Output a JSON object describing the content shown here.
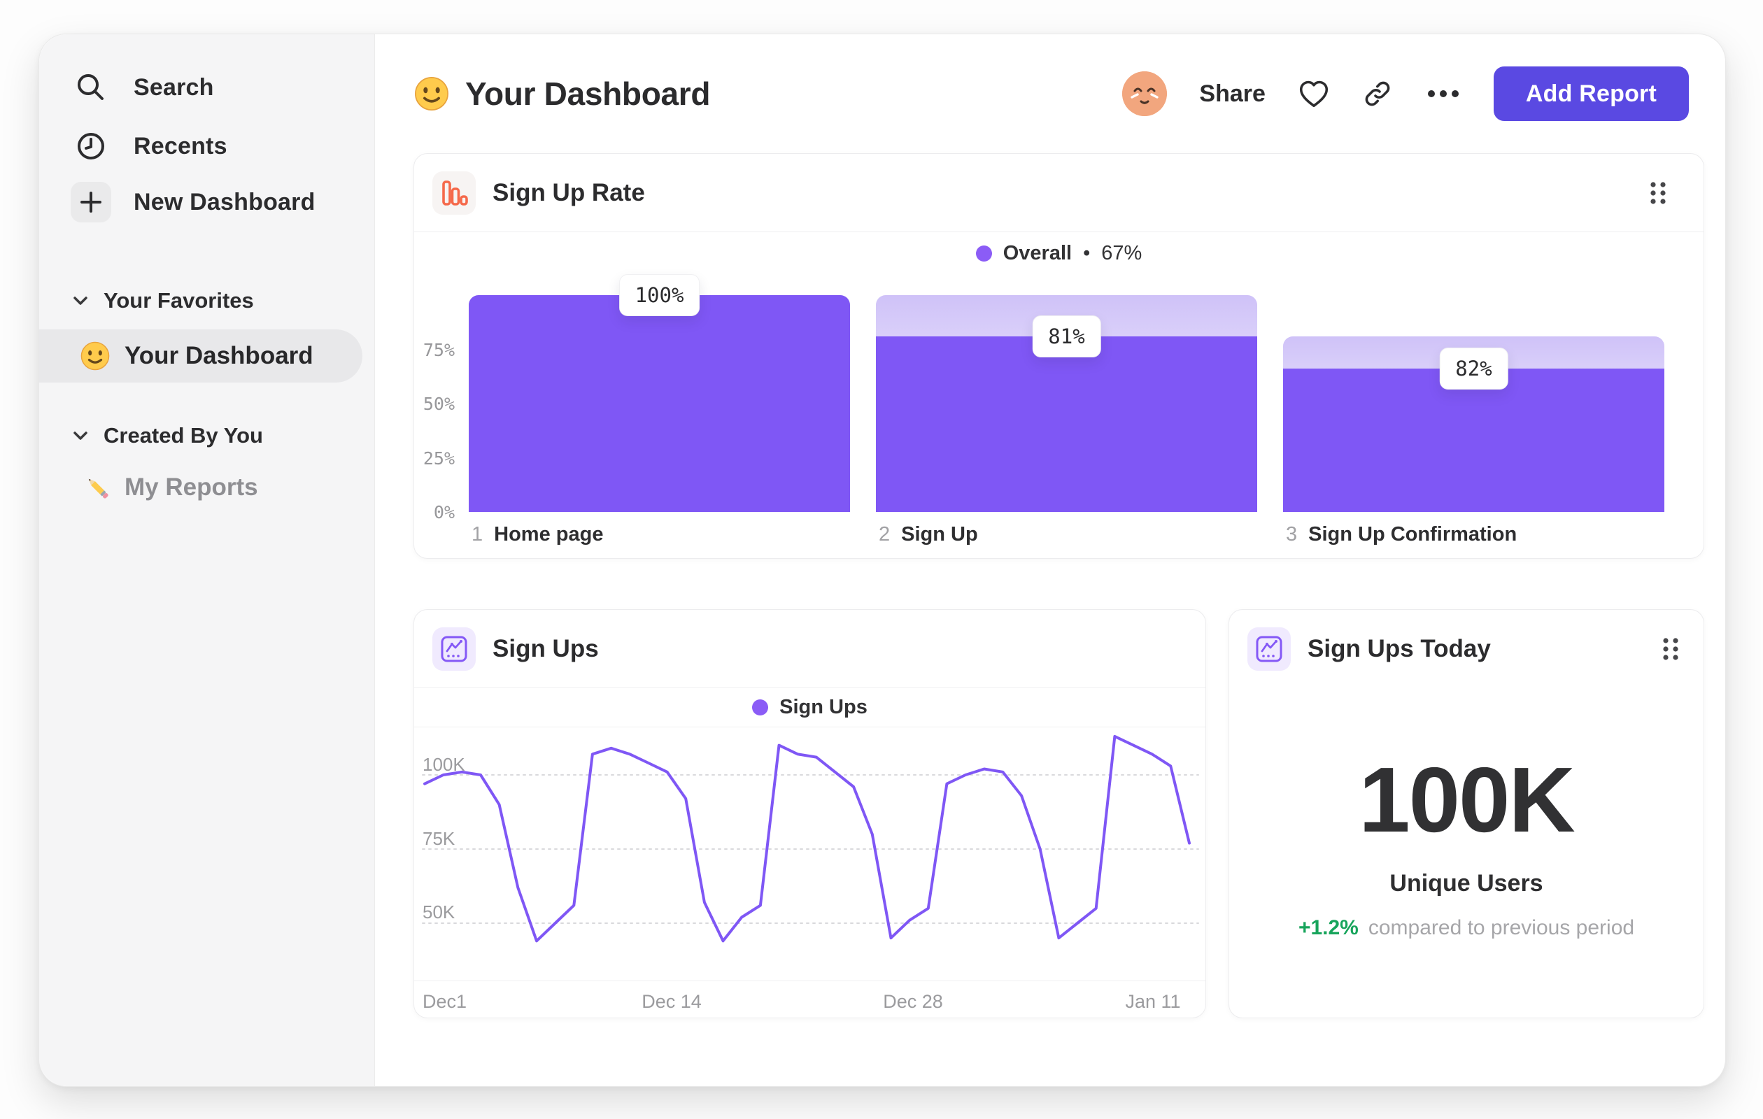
{
  "sidebar": {
    "items": [
      {
        "label": "Search",
        "icon": "search-icon"
      },
      {
        "label": "Recents",
        "icon": "clock-icon"
      },
      {
        "label": "New Dashboard",
        "icon": "plus-icon"
      }
    ],
    "sections": [
      {
        "title": "Your Favorites",
        "items": [
          {
            "label": "Your Dashboard",
            "icon": "smiley-emoji",
            "selected": true
          }
        ]
      },
      {
        "title": "Created By You",
        "items": [
          {
            "label": "My Reports",
            "icon": "pencil-emoji",
            "selected": false
          }
        ]
      }
    ]
  },
  "header": {
    "emoji": "smiley-emoji",
    "title": "Your Dashboard",
    "share_label": "Share",
    "add_report_label": "Add Report",
    "ellipsis": "•••"
  },
  "cards": {
    "sign_ups_today": {
      "title": "Sign Ups Today",
      "value": "100K",
      "metric_label": "Unique Users",
      "delta": "+1.2%",
      "delta_note": "compared to previous period"
    }
  },
  "colors": {
    "accent": "#7f57f5",
    "legend_dot": "#8b5cf6",
    "button": "#5a49e2",
    "positive": "#17a45b",
    "funnel_icon_orange": "#f5694b",
    "ghost_gradient_top": "#cfc2f8",
    "avatar_bg": "#f2a67e"
  },
  "chart_data": [
    {
      "type": "bar",
      "subtype": "funnel",
      "title": "Sign Up Rate",
      "legend": {
        "series": "Overall",
        "separator": "•",
        "value": "67%",
        "position": "top-center"
      },
      "categories": [
        "Home page",
        "Sign Up",
        "Sign Up Confirmation"
      ],
      "step_numbers": [
        "1",
        "2",
        "3"
      ],
      "step_conversion_labels": [
        "100%",
        "81%",
        "82%"
      ],
      "overall_pct": [
        100,
        81,
        66
      ],
      "ghost_pct": [
        null,
        100,
        81
      ],
      "y_ticks": [
        "0%",
        "25%",
        "50%",
        "75%"
      ],
      "ylim": [
        0,
        100
      ],
      "grid": false
    },
    {
      "type": "line",
      "title": "Sign Ups",
      "legend": {
        "series": "Sign Ups",
        "position": "top-center"
      },
      "x_tick_labels": [
        "Dec1",
        "Dec 14",
        "Dec 28",
        "Jan 11"
      ],
      "y_ticks": [
        {
          "label": "100K",
          "value": 100
        },
        {
          "label": "75K",
          "value": 75
        },
        {
          "label": "50K",
          "value": 50
        }
      ],
      "unit": "K",
      "values_k": [
        97,
        100,
        101,
        100,
        90,
        62,
        44,
        50,
        56,
        107,
        109,
        107,
        104,
        101,
        92,
        57,
        44,
        52,
        56,
        110,
        107,
        106,
        101,
        96,
        80,
        45,
        51,
        55,
        97,
        100,
        102,
        101,
        93,
        75,
        45,
        50,
        55,
        113,
        110,
        107,
        103,
        77
      ],
      "ylim_k": [
        30,
        118
      ],
      "grid": "dashed-horizontal"
    }
  ]
}
